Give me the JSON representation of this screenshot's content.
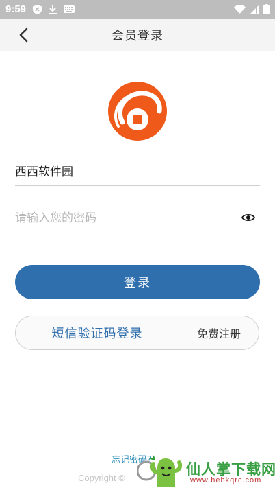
{
  "status_bar": {
    "time": "9:59",
    "left_icons": [
      "shield-icon",
      "download-icon",
      "keyboard-icon"
    ],
    "right_icons": [
      "wifi-icon",
      "cellular-signal-icon",
      "battery-icon"
    ]
  },
  "header": {
    "title": "会员登录",
    "back_icon": "chevron-left-icon"
  },
  "logo": {
    "icon": "app-logo-icon",
    "color": "#ef5a1a"
  },
  "form": {
    "username": {
      "value": "西西软件园",
      "placeholder": ""
    },
    "password": {
      "value": "",
      "placeholder": "请输入您的密码",
      "toggle_icon": "eye-icon"
    }
  },
  "buttons": {
    "login_label": "登录",
    "sms_login_label": "短信验证码登录",
    "register_label": "免费注册"
  },
  "footer": {
    "forgot_password": "忘记密码?",
    "copyright": "Copyright ©"
  },
  "watermark": {
    "title": "仙人掌下载网",
    "subtitle": "www.hebkqrc.com"
  },
  "colors": {
    "accent": "#2f6fae",
    "header_bg": "#f4f4f4",
    "status_bar_bg": "#bdbdbd",
    "logo_orange": "#ef5a1a"
  }
}
